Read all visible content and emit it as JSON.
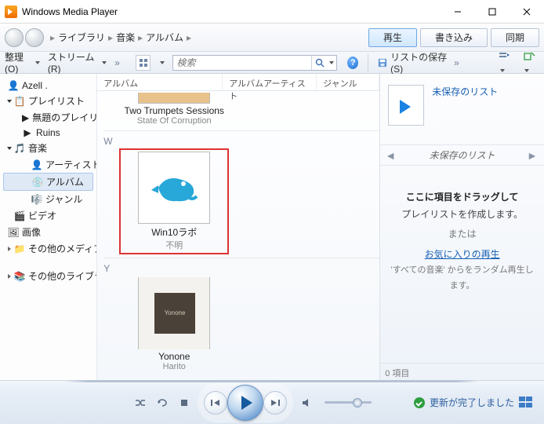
{
  "app": {
    "title": "Windows Media Player"
  },
  "nav": {
    "crumbs": [
      "ライブラリ",
      "音楽",
      "アルバム"
    ],
    "tabs": {
      "play": "再生",
      "burn": "書き込み",
      "sync": "同期"
    }
  },
  "toolbar": {
    "organize": "整理(O)",
    "stream": "ストリーム(R)",
    "search_placeholder": "検索",
    "save_list": "リストの保存(S)"
  },
  "sidebar": {
    "user": "Azell .",
    "playlist": "プレイリスト",
    "playlist_items": [
      "無題のプレイリスト",
      "Ruins"
    ],
    "music": "音楽",
    "music_items": [
      "アーティスト",
      "アルバム",
      "ジャンル"
    ],
    "video": "ビデオ",
    "image": "画像",
    "other_media": "その他のメディア",
    "other_lib": "その他のライブラリ"
  },
  "columns": {
    "album": "アルバム",
    "album_artist": "アルバムアーティスト",
    "genre": "ジャンル"
  },
  "albums": {
    "t": {
      "name": "Two Trumpets Sessions",
      "artist": "State Of Corruption"
    },
    "w_letter": "W",
    "w": {
      "name": "Win10ラボ",
      "artist": "不明"
    },
    "y_letter": "Y",
    "y": {
      "name": "Yonone",
      "artist": "Harito",
      "cover_text": "Yonone"
    }
  },
  "right": {
    "unsaved_link": "未保存のリスト",
    "unsaved_title": "未保存のリスト",
    "drag_bold": "ここに項目をドラッグして",
    "drag_line2": "プレイリストを作成します。",
    "or": "または",
    "fav_play": "お気に入りの再生",
    "random": "'すべての音楽' からをランダム再生します。",
    "count": "0 項目"
  },
  "status": {
    "text": "更新が完了しました"
  }
}
